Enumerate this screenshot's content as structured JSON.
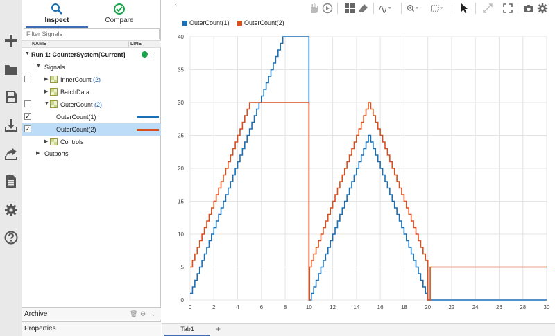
{
  "rail": {
    "icons": [
      "add-icon",
      "folder-icon",
      "save-icon",
      "import-icon",
      "export-icon",
      "report-icon",
      "settings-icon",
      "help-icon"
    ]
  },
  "panel": {
    "tabs": [
      {
        "label": "Inspect",
        "icon": "search-icon"
      },
      {
        "label": "Compare",
        "icon": "compare-check-icon"
      }
    ],
    "filter_placeholder": "Filter Signals",
    "columns": {
      "name": "NAME",
      "line": "LINE"
    },
    "run_label": "Run 1: CounterSystem[Current]",
    "tree": {
      "signals_label": "Signals",
      "inner_count": {
        "label": "InnerCount",
        "count": "(2)"
      },
      "batch_data": {
        "label": "BatchData"
      },
      "outer_count": {
        "label": "OuterCount",
        "count": "(2)"
      },
      "outer_count_1": {
        "label": "OuterCount(1)",
        "checked": true
      },
      "outer_count_2": {
        "label": "OuterCount(2)",
        "checked": true
      },
      "controls": {
        "label": "Controls"
      },
      "outports_label": "Outports"
    },
    "archive_label": "Archive",
    "properties_label": "Properties"
  },
  "toolbar": {
    "icons": [
      "pan-icon",
      "play-icon",
      "layout-grid-icon",
      "eraser-icon",
      "signal-style-icon",
      "zoom-icon",
      "fit-view-icon",
      "cursor-icon",
      "expand-icon",
      "fullscreen-icon",
      "camera-icon",
      "gear-icon"
    ]
  },
  "tabs": {
    "tab1": "Tab1",
    "add": "+"
  },
  "colors": {
    "series1": "#1a6fb5",
    "series2": "#d94f1d",
    "accent": "#3d6cb5"
  },
  "chart_data": {
    "type": "line",
    "step": true,
    "xlim": [
      0,
      30
    ],
    "ylim": [
      0,
      40
    ],
    "xticks": [
      0,
      2,
      4,
      6,
      8,
      10,
      12,
      14,
      16,
      18,
      20,
      22,
      24,
      26,
      28,
      30
    ],
    "yticks": [
      0,
      5,
      10,
      15,
      20,
      25,
      30,
      35,
      40
    ],
    "grid": true,
    "legend": "top-left",
    "series": [
      {
        "name": "OuterCount(1)",
        "color": "#1a6fb5",
        "points": [
          [
            0,
            1
          ],
          [
            0.2,
            2
          ],
          [
            0.4,
            3
          ],
          [
            0.6,
            4
          ],
          [
            0.8,
            5
          ],
          [
            1,
            6
          ],
          [
            1.2,
            7
          ],
          [
            1.4,
            8
          ],
          [
            1.6,
            9
          ],
          [
            1.8,
            10
          ],
          [
            2,
            11
          ],
          [
            2.2,
            12
          ],
          [
            2.4,
            13
          ],
          [
            2.6,
            14
          ],
          [
            2.8,
            15
          ],
          [
            3,
            16
          ],
          [
            3.2,
            17
          ],
          [
            3.4,
            18
          ],
          [
            3.6,
            19
          ],
          [
            3.8,
            20
          ],
          [
            4,
            21
          ],
          [
            4.2,
            22
          ],
          [
            4.4,
            23
          ],
          [
            4.6,
            24
          ],
          [
            4.8,
            25
          ],
          [
            5,
            26
          ],
          [
            5.2,
            27
          ],
          [
            5.4,
            28
          ],
          [
            5.6,
            29
          ],
          [
            5.8,
            30
          ],
          [
            6,
            31
          ],
          [
            6.2,
            32
          ],
          [
            6.4,
            33
          ],
          [
            6.6,
            34
          ],
          [
            6.8,
            35
          ],
          [
            7,
            36
          ],
          [
            7.2,
            37
          ],
          [
            7.4,
            38
          ],
          [
            7.6,
            39
          ],
          [
            7.8,
            40
          ],
          [
            10,
            0
          ],
          [
            10.2,
            1
          ],
          [
            10.4,
            2
          ],
          [
            10.6,
            3
          ],
          [
            10.8,
            4
          ],
          [
            11,
            5
          ],
          [
            11.2,
            6
          ],
          [
            11.4,
            7
          ],
          [
            11.6,
            8
          ],
          [
            11.8,
            9
          ],
          [
            12,
            10
          ],
          [
            12.2,
            11
          ],
          [
            12.4,
            12
          ],
          [
            12.6,
            13
          ],
          [
            12.8,
            14
          ],
          [
            13,
            15
          ],
          [
            13.2,
            16
          ],
          [
            13.4,
            17
          ],
          [
            13.6,
            18
          ],
          [
            13.8,
            19
          ],
          [
            14,
            20
          ],
          [
            14.2,
            21
          ],
          [
            14.4,
            22
          ],
          [
            14.6,
            23
          ],
          [
            14.8,
            24
          ],
          [
            15,
            25
          ],
          [
            15.2,
            24
          ],
          [
            15.4,
            23
          ],
          [
            15.6,
            22
          ],
          [
            15.8,
            21
          ],
          [
            16,
            20
          ],
          [
            16.2,
            19
          ],
          [
            16.4,
            18
          ],
          [
            16.6,
            17
          ],
          [
            16.8,
            16
          ],
          [
            17,
            15
          ],
          [
            17.2,
            14
          ],
          [
            17.4,
            13
          ],
          [
            17.6,
            12
          ],
          [
            17.8,
            11
          ],
          [
            18,
            10
          ],
          [
            18.2,
            9
          ],
          [
            18.4,
            8
          ],
          [
            18.6,
            7
          ],
          [
            18.8,
            6
          ],
          [
            19,
            5
          ],
          [
            19.2,
            4
          ],
          [
            19.4,
            3
          ],
          [
            19.6,
            2
          ],
          [
            19.8,
            1
          ],
          [
            20,
            0
          ],
          [
            30,
            0
          ]
        ]
      },
      {
        "name": "OuterCount(2)",
        "color": "#d94f1d",
        "points": [
          [
            0,
            5
          ],
          [
            0.2,
            6
          ],
          [
            0.4,
            7
          ],
          [
            0.6,
            8
          ],
          [
            0.8,
            9
          ],
          [
            1,
            10
          ],
          [
            1.2,
            11
          ],
          [
            1.4,
            12
          ],
          [
            1.6,
            13
          ],
          [
            1.8,
            14
          ],
          [
            2,
            15
          ],
          [
            2.2,
            16
          ],
          [
            2.4,
            17
          ],
          [
            2.6,
            18
          ],
          [
            2.8,
            19
          ],
          [
            3,
            20
          ],
          [
            3.2,
            21
          ],
          [
            3.4,
            22
          ],
          [
            3.6,
            23
          ],
          [
            3.8,
            24
          ],
          [
            4,
            25
          ],
          [
            4.2,
            26
          ],
          [
            4.4,
            27
          ],
          [
            4.6,
            28
          ],
          [
            4.8,
            29
          ],
          [
            5,
            30
          ],
          [
            10,
            0
          ],
          [
            10.05,
            5
          ],
          [
            10.2,
            6
          ],
          [
            10.4,
            7
          ],
          [
            10.6,
            8
          ],
          [
            10.8,
            9
          ],
          [
            11,
            10
          ],
          [
            11.2,
            11
          ],
          [
            11.4,
            12
          ],
          [
            11.6,
            13
          ],
          [
            11.8,
            14
          ],
          [
            12,
            15
          ],
          [
            12.2,
            16
          ],
          [
            12.4,
            17
          ],
          [
            12.6,
            18
          ],
          [
            12.8,
            19
          ],
          [
            13,
            20
          ],
          [
            13.2,
            21
          ],
          [
            13.4,
            22
          ],
          [
            13.6,
            23
          ],
          [
            13.8,
            24
          ],
          [
            14,
            25
          ],
          [
            14.2,
            26
          ],
          [
            14.4,
            27
          ],
          [
            14.6,
            28
          ],
          [
            14.8,
            29
          ],
          [
            15,
            30
          ],
          [
            15.2,
            29
          ],
          [
            15.4,
            28
          ],
          [
            15.6,
            27
          ],
          [
            15.8,
            26
          ],
          [
            16,
            25
          ],
          [
            16.2,
            24
          ],
          [
            16.4,
            23
          ],
          [
            16.6,
            22
          ],
          [
            16.8,
            21
          ],
          [
            17,
            20
          ],
          [
            17.2,
            19
          ],
          [
            17.4,
            18
          ],
          [
            17.6,
            17
          ],
          [
            17.8,
            16
          ],
          [
            18,
            15
          ],
          [
            18.2,
            14
          ],
          [
            18.4,
            13
          ],
          [
            18.6,
            12
          ],
          [
            18.8,
            11
          ],
          [
            19,
            10
          ],
          [
            19.2,
            9
          ],
          [
            19.4,
            8
          ],
          [
            19.6,
            7
          ],
          [
            19.8,
            6
          ],
          [
            20,
            0
          ],
          [
            20.2,
            5
          ],
          [
            30,
            5
          ]
        ]
      }
    ]
  }
}
